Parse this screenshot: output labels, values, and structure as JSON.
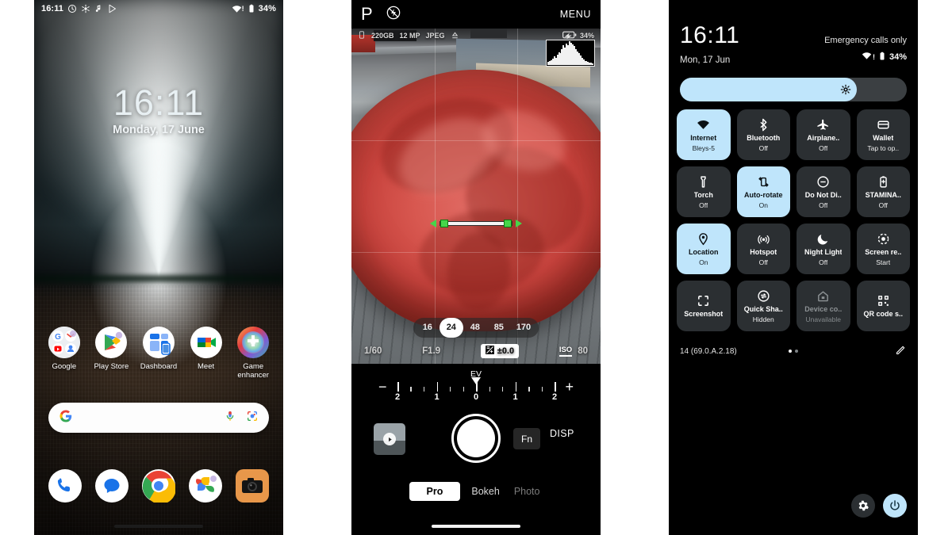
{
  "phone_home": {
    "status_bar": {
      "time": "16:11",
      "icons": [
        "clock-alarm-icon",
        "bluetooth-audio-icon",
        "music-note-icon",
        "play-store-icon"
      ],
      "right_icons": [
        "wifi-icon",
        "battery-icon"
      ],
      "battery": "34%"
    },
    "clock": "16:11",
    "date": "Monday, 17 June",
    "apps": [
      {
        "label": "Google",
        "icon": "google-folder-icon"
      },
      {
        "label": "Play Store",
        "icon": "play-store-icon"
      },
      {
        "label": "Dashboard",
        "icon": "dashboard-icon"
      },
      {
        "label": "Meet",
        "icon": "google-meet-icon"
      },
      {
        "label": "Game enhancer",
        "icon": "game-enhancer-icon"
      }
    ],
    "search": {
      "placeholder": "",
      "value": "",
      "leading_icon": "google-g-icon",
      "mic_icon": "microphone-icon",
      "lens_icon": "google-lens-icon"
    },
    "dock": [
      {
        "label": "Phone",
        "icon": "phone-icon"
      },
      {
        "label": "Messages",
        "icon": "messages-icon"
      },
      {
        "label": "Chrome",
        "icon": "chrome-icon"
      },
      {
        "label": "Photos",
        "icon": "google-photos-icon"
      },
      {
        "label": "Camera",
        "icon": "camera-icon"
      }
    ]
  },
  "phone_camera": {
    "top_bar": {
      "mode_letter": "P",
      "flash_icon": "flash-off-icon",
      "menu_label": "MENU"
    },
    "info_bar": {
      "storage_icon": "storage-icon",
      "storage": "220GB",
      "resolution": "12 MP",
      "format": "JPEG",
      "upload_icon": "cloud-upload-icon",
      "battery_icon": "battery-charging-icon",
      "battery": "34%"
    },
    "histogram_bars": [
      4,
      5,
      7,
      9,
      12,
      10,
      14,
      18,
      16,
      22,
      28,
      24,
      30,
      27,
      33,
      31,
      29,
      26,
      22,
      19,
      16,
      13,
      10,
      8,
      6,
      5,
      4,
      3,
      3,
      2
    ],
    "lens_options": [
      "16",
      "24",
      "48",
      "85",
      "170"
    ],
    "lens_active": "24",
    "exposure": {
      "shutter": "1/60",
      "aperture": "F1.9",
      "ev_icon": "exposure-comp-icon",
      "ev_value": "±0.0",
      "iso_label": "ISO",
      "iso_value": "80"
    },
    "ev_slider": {
      "title": "EV",
      "minus": "−",
      "plus": "+",
      "labels": [
        "2",
        "1",
        "0",
        "1",
        "2"
      ],
      "marker_position": "0"
    },
    "controls": {
      "thumbnail_icon": "gallery-thumbnail-play-icon",
      "shutter_icon": "shutter-button",
      "fn_label": "Fn",
      "disp_label": "DISP"
    },
    "modes": [
      {
        "label": "Pro",
        "state": "active"
      },
      {
        "label": "Bokeh",
        "state": "normal"
      },
      {
        "label": "Photo",
        "state": "dim"
      }
    ]
  },
  "phone_quicksettings": {
    "clock": "16:11",
    "date": "Mon, 17 Jun",
    "carrier": "Emergency calls only",
    "wifi_icon": "wifi-icon",
    "battery_icon": "battery-icon",
    "battery": "34%",
    "brightness": {
      "icon": "brightness-icon",
      "level": 78
    },
    "tiles": [
      {
        "label": "Internet",
        "sub": "Bleys-5",
        "icon": "wifi-icon",
        "state": "on"
      },
      {
        "label": "Bluetooth",
        "sub": "Off",
        "icon": "bluetooth-icon",
        "state": "off"
      },
      {
        "label": "Airplane..",
        "sub": "Off",
        "icon": "airplane-icon",
        "state": "off"
      },
      {
        "label": "Wallet",
        "sub": "Tap to op..",
        "icon": "wallet-icon",
        "state": "off"
      },
      {
        "label": "Torch",
        "sub": "Off",
        "icon": "torch-icon",
        "state": "off"
      },
      {
        "label": "Auto-rotate",
        "sub": "On",
        "icon": "auto-rotate-icon",
        "state": "on"
      },
      {
        "label": "Do Not Di..",
        "sub": "Off",
        "icon": "do-not-disturb-icon",
        "state": "off"
      },
      {
        "label": "STAMINA..",
        "sub": "Off",
        "icon": "battery-saver-icon",
        "state": "off"
      },
      {
        "label": "Location",
        "sub": "On",
        "icon": "location-pin-icon",
        "state": "on"
      },
      {
        "label": "Hotspot",
        "sub": "Off",
        "icon": "hotspot-icon",
        "state": "off"
      },
      {
        "label": "Night Light",
        "sub": "Off",
        "icon": "moon-icon",
        "state": "off"
      },
      {
        "label": "Screen re..",
        "sub": "Start",
        "icon": "screen-record-icon",
        "state": "off"
      },
      {
        "label": "Screenshot",
        "sub": "",
        "icon": "screenshot-icon",
        "state": "off"
      },
      {
        "label": "Quick Sha..",
        "sub": "Hidden",
        "icon": "quick-share-icon",
        "state": "off"
      },
      {
        "label": "Device co..",
        "sub": "Unavailable",
        "icon": "home-device-icon",
        "state": "disabled"
      },
      {
        "label": "QR code s..",
        "sub": "",
        "icon": "qr-code-icon",
        "state": "off"
      }
    ],
    "footer": {
      "build": "14 (69.0.A.2.18)",
      "page_dots": 2,
      "active_dot": 0,
      "edit_icon": "pencil-edit-icon"
    },
    "bottom": {
      "settings_icon": "gear-icon",
      "power_icon": "power-icon"
    }
  }
}
